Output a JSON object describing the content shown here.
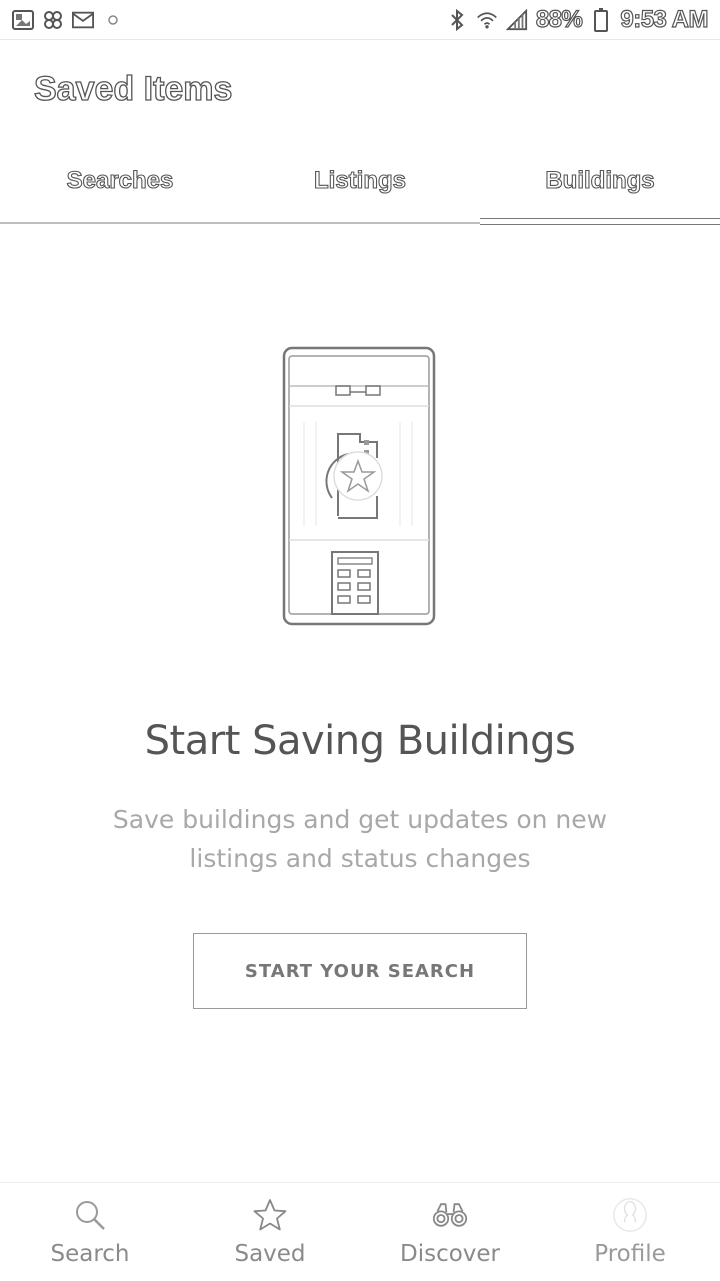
{
  "status_bar": {
    "battery": "88%",
    "time": "9:53 AM",
    "left_icons": [
      "image-icon",
      "pinwheel-icon",
      "gmail-icon",
      "dot-icon"
    ],
    "right_icons": [
      "bluetooth-icon",
      "wifi-icon",
      "signal-icon",
      "battery-icon"
    ]
  },
  "header": {
    "title": "Saved Items"
  },
  "tabs": [
    {
      "label": "Searches",
      "active": false
    },
    {
      "label": "Listings",
      "active": false
    },
    {
      "label": "Buildings",
      "active": true
    }
  ],
  "empty_state": {
    "illustration": "phone-building-star-illustration",
    "title": "Start Saving Buildings",
    "description": "Save buildings and get updates on new listings and status changes",
    "button_label": "START YOUR SEARCH"
  },
  "bottom_nav": [
    {
      "label": "Search",
      "icon": "search-icon"
    },
    {
      "label": "Saved",
      "icon": "star-icon"
    },
    {
      "label": "Discover",
      "icon": "binoculars-icon"
    },
    {
      "label": "Profile",
      "icon": "profile-icon"
    }
  ],
  "colors": {
    "text_dark": "#555555",
    "text_muted": "#a8a8a8",
    "border": "#bdbdbd"
  }
}
